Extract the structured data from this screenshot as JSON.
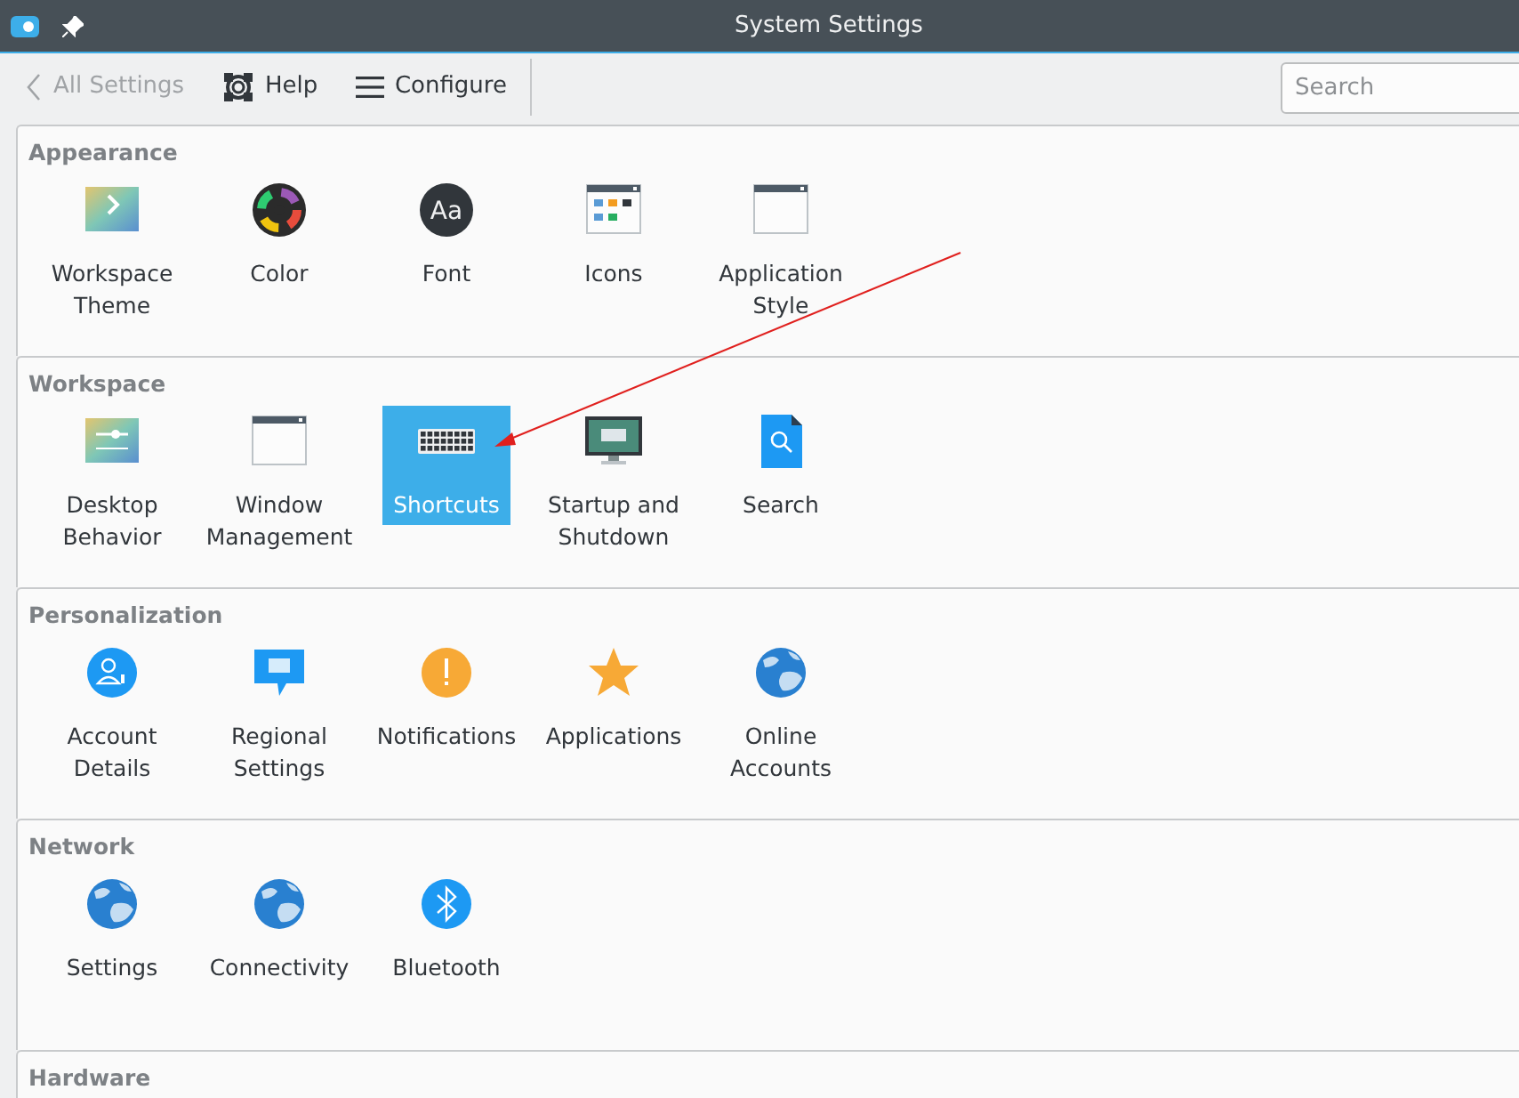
{
  "window": {
    "title": "System Settings"
  },
  "toolbar": {
    "back": {
      "label": "All Settings",
      "disabled": true
    },
    "buttons": [
      "Help",
      "Configure"
    ],
    "search": {
      "placeholder": "Search"
    }
  },
  "sections": [
    {
      "title": "Appearance",
      "items": [
        {
          "label": "Workspace Theme",
          "selected": false
        },
        {
          "label": "Color",
          "selected": false
        },
        {
          "label": "Font",
          "selected": false,
          "icon_text": "Aa"
        },
        {
          "label": "Icons",
          "selected": false
        },
        {
          "label": "Application Style",
          "selected": false
        }
      ]
    },
    {
      "title": "Workspace",
      "items": [
        {
          "label": "Desktop Behavior",
          "selected": false
        },
        {
          "label": "Window Management",
          "selected": false
        },
        {
          "label": "Shortcuts",
          "selected": true
        },
        {
          "label": "Startup and Shutdown",
          "selected": false
        },
        {
          "label": "Search",
          "selected": false
        }
      ]
    },
    {
      "title": "Personalization",
      "items": [
        {
          "label": "Account Details",
          "selected": false
        },
        {
          "label": "Regional Settings",
          "selected": false
        },
        {
          "label": "Notifications",
          "selected": false
        },
        {
          "label": "Applications",
          "selected": false
        },
        {
          "label": "Online Accounts",
          "selected": false
        }
      ]
    },
    {
      "title": "Network",
      "items": [
        {
          "label": "Settings",
          "selected": false
        },
        {
          "label": "Connectivity",
          "selected": false
        },
        {
          "label": "Bluetooth",
          "selected": false
        }
      ]
    },
    {
      "title": "Hardware"
    }
  ]
}
